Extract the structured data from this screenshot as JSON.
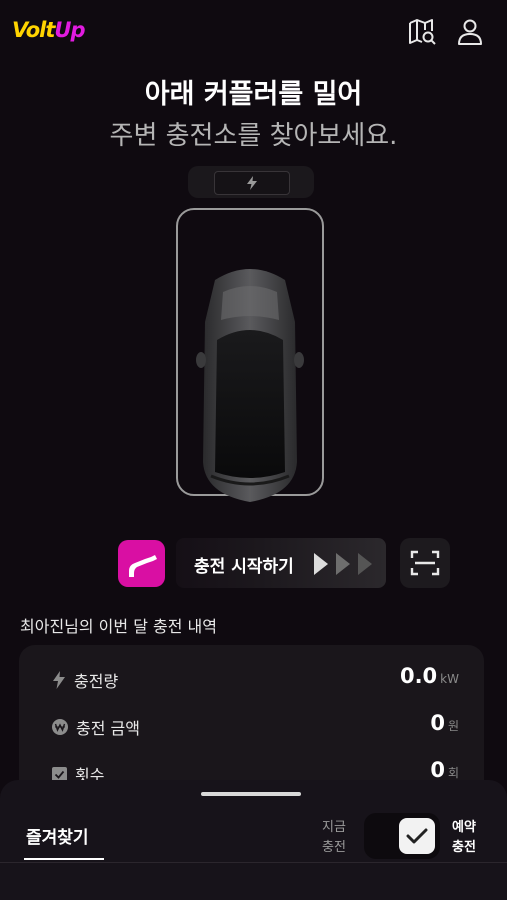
{
  "header": {
    "logo_part1": "Volt",
    "logo_part2": "Up",
    "icons": [
      "map-search-icon",
      "user-icon"
    ]
  },
  "headline": {
    "line1": "아래 커플러를 밀어",
    "line2": "주변 충전소를 찾아보세요."
  },
  "start_row": {
    "start_label": "충전 시작하기",
    "icons": [
      "charging-plug-icon",
      "chevron-right-icon",
      "qr-scan-icon"
    ]
  },
  "history": {
    "title": "최아진님의 이번 달 충전 내역",
    "rows": [
      {
        "label": "충전량",
        "value": "0.0",
        "unit": "kW",
        "icon": "lightning-icon"
      },
      {
        "label": "충전 금액",
        "value": "0",
        "unit": "원",
        "icon": "won-icon"
      },
      {
        "label": "횟수",
        "value": "0",
        "unit": "회",
        "icon": "checkbox-icon"
      }
    ]
  },
  "bottom_sheet": {
    "tab_label": "즐겨찾기",
    "mode_now_line1": "지금",
    "mode_now_line2": "충전",
    "mode_reserve_line1": "예약",
    "mode_reserve_line2": "충전"
  },
  "colors": {
    "background": "#0f0a10",
    "accent_magenta": "#d90fa3",
    "logo_yellow": "#ffd400",
    "logo_pink": "#e11be0",
    "card_bg": "#1a161b"
  }
}
